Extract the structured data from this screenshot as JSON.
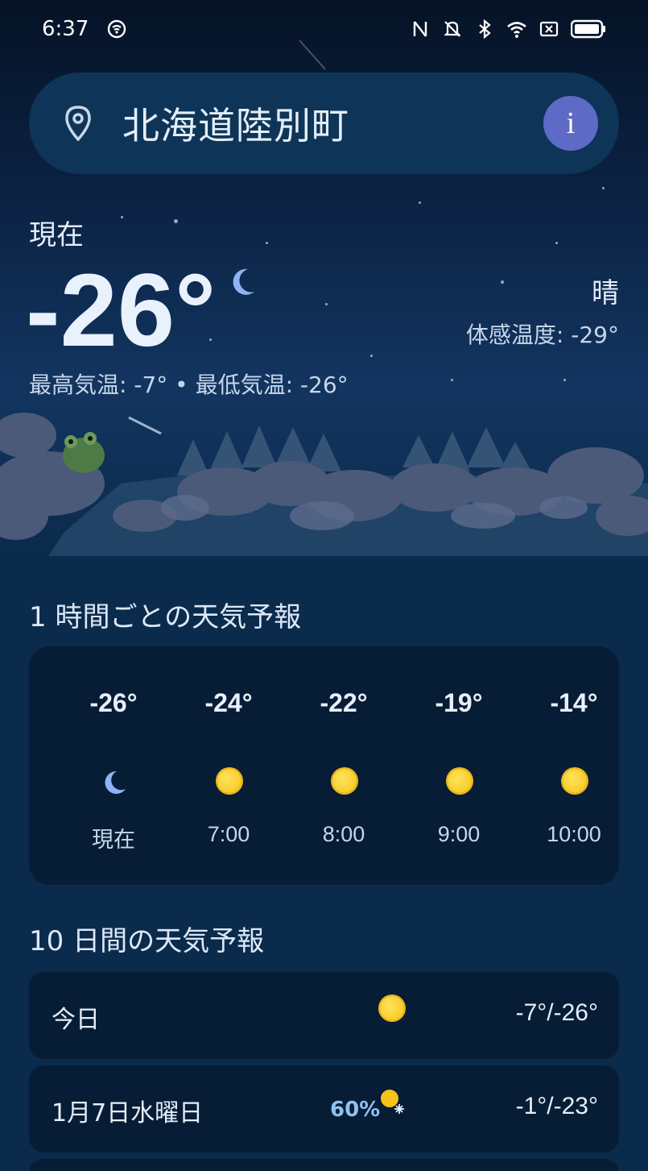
{
  "status_bar": {
    "time": "6:37"
  },
  "search": {
    "location": "北海道陸別町",
    "info_label": "i"
  },
  "current": {
    "label": "現在",
    "temperature": "-26°",
    "condition": "晴",
    "feels_like": "体感温度: -29°",
    "hi_lo": "最高気温: -7° • 最低気温: -26°"
  },
  "hourly": {
    "title": "1 時間ごとの天気予報",
    "items": [
      {
        "temp": "-26°",
        "time": "現在",
        "icon": "moon-icon"
      },
      {
        "temp": "-24°",
        "time": "7:00",
        "icon": "sun-icon"
      },
      {
        "temp": "-22°",
        "time": "8:00",
        "icon": "sun-icon"
      },
      {
        "temp": "-19°",
        "time": "9:00",
        "icon": "sun-icon"
      },
      {
        "temp": "-14°",
        "time": "10:00",
        "icon": "sun-icon"
      }
    ]
  },
  "daily": {
    "title": "10 日間の天気予報",
    "items": [
      {
        "day": "今日",
        "precip": "",
        "icon": "sun-icon",
        "temps": "-7°/-26°"
      },
      {
        "day": "1月7日水曜日",
        "precip": "60%",
        "icon": "sun-snow-icon",
        "temps": "-1°/-23°"
      }
    ]
  },
  "colors": {
    "background": "#0b2b4c",
    "card": "#071d35",
    "search_bar": "#0e3558",
    "info_button": "#5d6ac6",
    "precip_text": "#8fc0f0"
  }
}
